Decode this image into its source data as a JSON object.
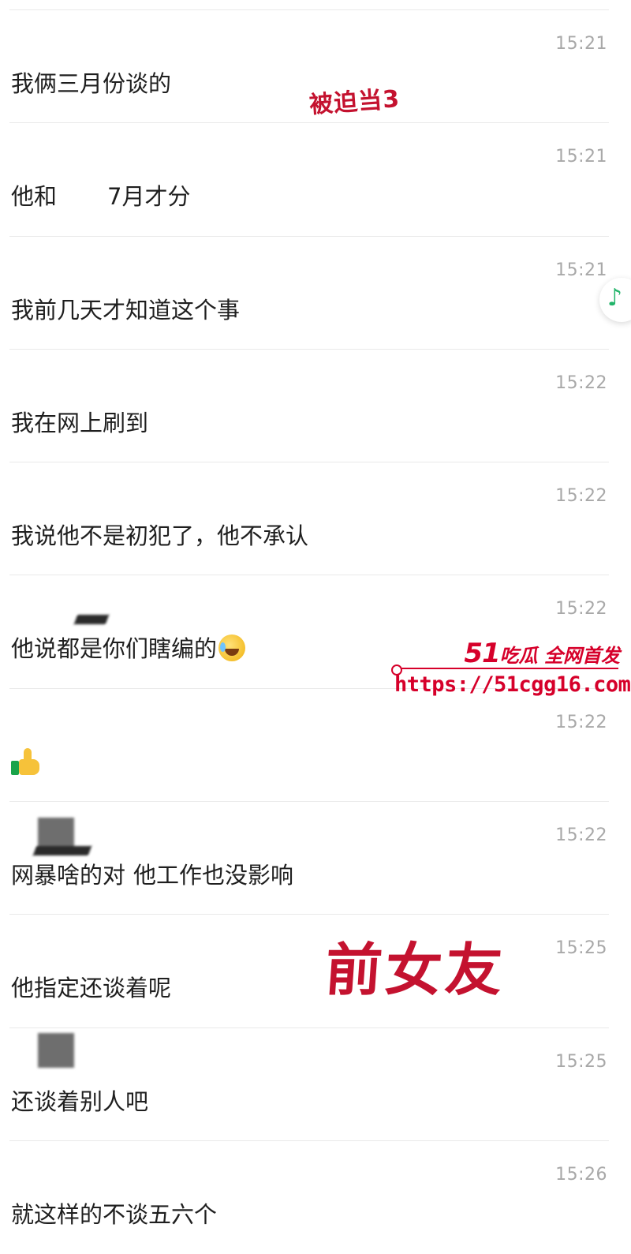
{
  "messages": [
    {
      "time": "15:21",
      "text": "我俩三月份谈的"
    },
    {
      "time": "15:21",
      "text_a": "他和",
      "text_b": "7月才分"
    },
    {
      "time": "15:21",
      "text": "我前几天才知道这个事"
    },
    {
      "time": "15:22",
      "text": "我在网上刷到"
    },
    {
      "time": "15:22",
      "text": "我说他不是初犯了，他不承认"
    },
    {
      "time": "15:22",
      "text": "他说都是你们瞎编的",
      "emoji": "laugh-cry-emoji"
    },
    {
      "time": "15:22",
      "emoji": "thumbs-up-icon"
    },
    {
      "time": "15:22",
      "text_a": "网暴啥的对",
      "text_b": "他工作也没影响"
    },
    {
      "time": "15:25",
      "text": "他指定还谈着呢"
    },
    {
      "time": "15:25",
      "text": "还谈着别人吧"
    },
    {
      "time": "15:26",
      "text": "就这样的不谈五六个"
    }
  ],
  "overlays": {
    "forced_third": "被迫当3",
    "ex_girlfriend": "前女友"
  },
  "watermark": {
    "number": "51",
    "title": "吃瓜 全网首发",
    "url": "https://51cgg16.com"
  },
  "floating_button": {
    "icon": "music-note-icon",
    "glyph": "♪"
  },
  "colors": {
    "time": "#a8a8a8",
    "message": "#1f1f1f",
    "divider": "#e9e9e9",
    "overlay_red": "#c4122f",
    "watermark_red": "#d6002a",
    "music_green": "#22b46a"
  }
}
